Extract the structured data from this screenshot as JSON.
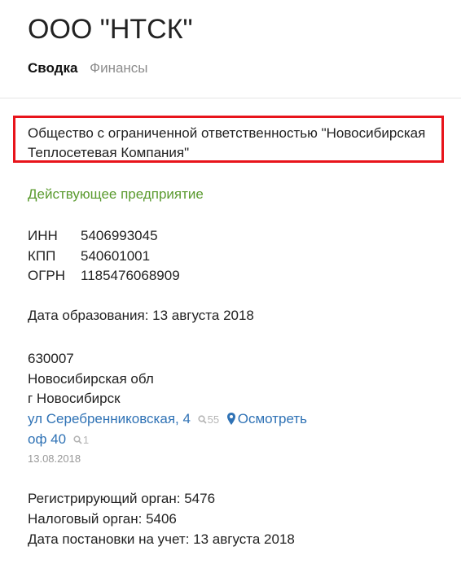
{
  "header": {
    "title": "ООО \"НТСК\"",
    "tabs": [
      {
        "label": "Сводка",
        "active": true
      },
      {
        "label": "Финансы",
        "active": false
      }
    ]
  },
  "company": {
    "full_name_line1": "Общество с ограниченной ответственностью \"Новосибирская",
    "full_name_line2": "Теплосетевая Компания\"",
    "status": "Действующее предприятие",
    "codes": [
      {
        "label": "ИНН",
        "value": "5406993045"
      },
      {
        "label": "КПП",
        "value": "540601001"
      },
      {
        "label": "ОГРН",
        "value": "1185476068909"
      }
    ],
    "registration_date": "Дата образования: 13 августа 2018"
  },
  "address": {
    "postal_code": "630007",
    "region": "Новосибирская обл",
    "city": "г Новосибирск",
    "street": "ул Серебренниковская, 4",
    "street_search_count": "55",
    "map_link": "Осмотреть",
    "office": "оф 40",
    "office_search_count": "1",
    "address_date": "13.08.2018"
  },
  "tax": {
    "registering_body": "Регистрирующий орган: 5476",
    "tax_body": "Налоговый орган: 5406",
    "registration_date": "Дата постановки на учет: 13 августа 2018"
  },
  "colors": {
    "status_green": "#5a9a2e",
    "link_blue": "#2f72b5",
    "highlight_red": "#e8141b"
  }
}
